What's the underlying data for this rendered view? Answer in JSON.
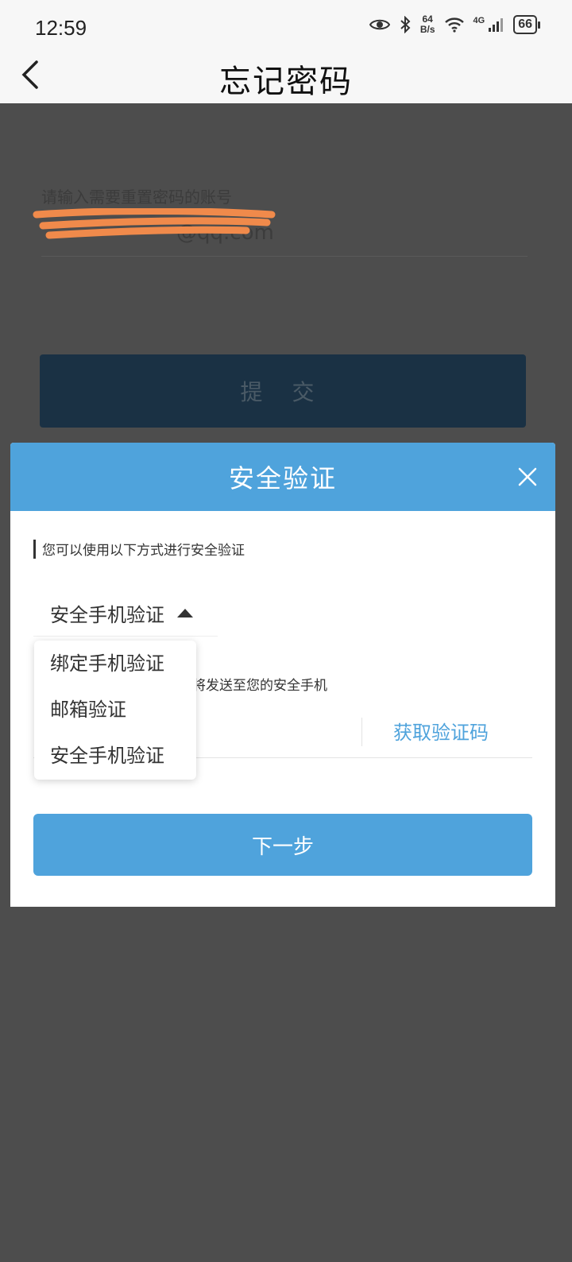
{
  "status_bar": {
    "time": "12:59",
    "net_speed_value": "64",
    "net_speed_unit": "B/s",
    "network_type": "4G",
    "battery": "66"
  },
  "header": {
    "title": "忘记密码"
  },
  "form": {
    "account_label": "请输入需要重置密码的账号",
    "account_value_visible": "@qq.com",
    "submit_label": "提 交"
  },
  "modal": {
    "title": "安全验证",
    "hint": "您可以使用以下方式进行安全验证",
    "selected_method": "安全手机验证",
    "send_hint_partial": "将发送至您的安全手机",
    "get_code_label": "获取验证码",
    "next_label": "下一步"
  },
  "dropdown": {
    "options": [
      "绑定手机验证",
      "邮箱验证",
      "安全手机验证"
    ]
  },
  "colors": {
    "accent": "#4fa3dc",
    "overlay": "#4d4d4d",
    "redaction": "#f08a4b"
  }
}
